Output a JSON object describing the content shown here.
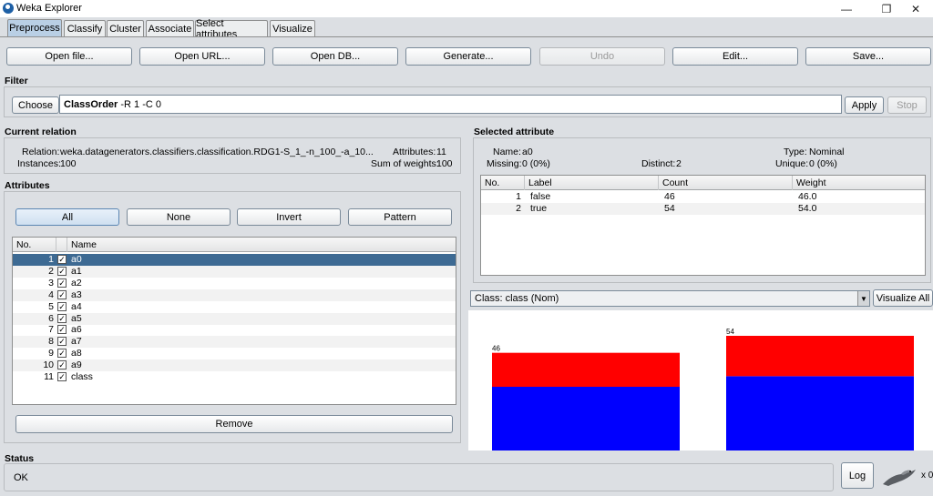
{
  "window": {
    "title": "Weka Explorer",
    "minimize": "—",
    "restore": "❐",
    "close": "✕"
  },
  "tabs": [
    {
      "label": "Preprocess"
    },
    {
      "label": "Classify"
    },
    {
      "label": "Cluster"
    },
    {
      "label": "Associate"
    },
    {
      "label": "Select attributes"
    },
    {
      "label": "Visualize"
    }
  ],
  "toolbar": {
    "open_file": "Open file...",
    "open_url": "Open URL...",
    "open_db": "Open DB...",
    "generate": "Generate...",
    "undo": "Undo",
    "edit": "Edit...",
    "save": "Save..."
  },
  "filter": {
    "section": "Filter",
    "choose": "Choose",
    "bold": "ClassOrder",
    "args": " -R 1 -C 0",
    "apply": "Apply",
    "stop": "Stop"
  },
  "relation": {
    "section": "Current relation",
    "relation_label": "Relation:",
    "relation_value": "weka.datagenerators.classifiers.classification.RDG1-S_1_-n_100_-a_10...",
    "attributes_label": "Attributes:",
    "attributes_value": "11",
    "instances_label": "Instances:",
    "instances_value": "100",
    "weights_label": "Sum of weights:",
    "weights_value": "100"
  },
  "attributes": {
    "section": "Attributes",
    "all": "All",
    "none": "None",
    "invert": "Invert",
    "pattern": "Pattern",
    "col_no": "No.",
    "col_name": "Name",
    "rows": [
      {
        "no": "1",
        "name": "a0"
      },
      {
        "no": "2",
        "name": "a1"
      },
      {
        "no": "3",
        "name": "a2"
      },
      {
        "no": "4",
        "name": "a3"
      },
      {
        "no": "5",
        "name": "a4"
      },
      {
        "no": "6",
        "name": "a5"
      },
      {
        "no": "7",
        "name": "a6"
      },
      {
        "no": "8",
        "name": "a7"
      },
      {
        "no": "9",
        "name": "a8"
      },
      {
        "no": "10",
        "name": "a9"
      },
      {
        "no": "11",
        "name": "class"
      }
    ],
    "check": "✓",
    "remove": "Remove"
  },
  "selected": {
    "section": "Selected attribute",
    "name_label": "Name:",
    "name_value": "a0",
    "type_label": "Type:",
    "type_value": "Nominal",
    "missing_label": "Missing:",
    "missing_value": "0 (0%)",
    "distinct_label": "Distinct:",
    "distinct_value": "2",
    "unique_label": "Unique:",
    "unique_value": "0 (0%)",
    "cols": {
      "no": "No.",
      "label": "Label",
      "count": "Count",
      "weight": "Weight"
    },
    "rows": [
      {
        "no": "1",
        "label": "false",
        "count": "46",
        "weight": "46.0"
      },
      {
        "no": "2",
        "label": "true",
        "count": "54",
        "weight": "54.0"
      }
    ]
  },
  "class_combo": {
    "value": "Class: class (Nom)",
    "arrow": "▼",
    "visualize_all": "Visualize All"
  },
  "colors": {
    "red": "#ff0000",
    "blue": "#0000ff",
    "selection": "#3d6a93",
    "tab_active": "#b9cfe5"
  },
  "chart_data": {
    "type": "bar",
    "categories": [
      "false",
      "true"
    ],
    "series": [
      {
        "values": [
          16,
          19
        ]
      },
      {
        "values": [
          30,
          35
        ]
      }
    ],
    "totals": [
      "46",
      "54"
    ],
    "ylim": [
      0,
      54
    ]
  },
  "status": {
    "section": "Status",
    "text": "OK",
    "log": "Log",
    "count": "x 0"
  }
}
